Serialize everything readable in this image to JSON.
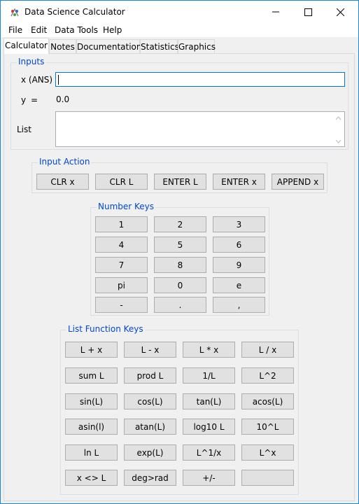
{
  "window": {
    "title": "Data Science Calculator"
  },
  "menu": [
    "File",
    "Edit",
    "Data Tools",
    "Help"
  ],
  "tabs": [
    "Calculator",
    "Notes",
    "Documentation",
    "Statistics",
    "Graphics"
  ],
  "inputs": {
    "title": "Inputs",
    "x_label": "x (ANS)",
    "x_value": "",
    "y_label": "y",
    "y_eq": "=",
    "y_value": "0.0",
    "list_label": "List",
    "list_value": ""
  },
  "input_action": {
    "title": "Input Action",
    "buttons": [
      "CLR x",
      "CLR L",
      "ENTER L",
      "ENTER x",
      "APPEND x"
    ]
  },
  "number_keys": {
    "title": "Number Keys",
    "buttons": [
      "1",
      "2",
      "3",
      "4",
      "5",
      "6",
      "7",
      "8",
      "9",
      "pi",
      "0",
      "e",
      "-",
      ".",
      ","
    ]
  },
  "list_function_keys": {
    "title": "List Function Keys",
    "buttons": [
      "L + x",
      "L - x",
      "L * x",
      "L / x",
      "sum L",
      "prod L",
      "1/L",
      "L^2",
      "sin(L)",
      "cos(L)",
      "tan(L)",
      "acos(L)",
      "asin(l)",
      "atan(L)",
      "log10 L",
      "10^L",
      "ln L",
      "exp(L)",
      "L^1/x",
      "L^x",
      "x <> L",
      "deg>rad",
      "+/-",
      ""
    ]
  }
}
